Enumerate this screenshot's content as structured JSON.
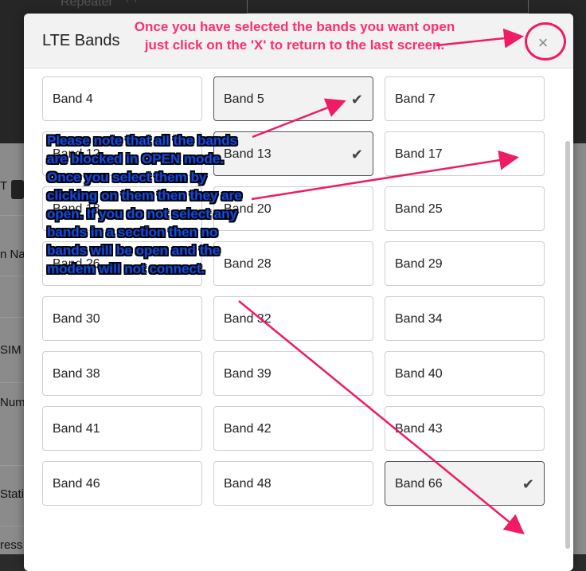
{
  "background": {
    "repeater_label": "Repeater",
    "side_labels": [
      "T",
      "n Na",
      "SIM",
      "Num",
      "Stati",
      "ress"
    ]
  },
  "modal": {
    "title": "LTE Bands",
    "close_symbol": "×",
    "bands": [
      {
        "label": "Band 4",
        "selected": false
      },
      {
        "label": "Band 5",
        "selected": true
      },
      {
        "label": "Band 7",
        "selected": false
      },
      {
        "label": "Band 12",
        "selected": false
      },
      {
        "label": "Band 13",
        "selected": true
      },
      {
        "label": "Band 17",
        "selected": false
      },
      {
        "label": "Band 18",
        "selected": false
      },
      {
        "label": "Band 20",
        "selected": false
      },
      {
        "label": "Band 25",
        "selected": false
      },
      {
        "label": "Band 26",
        "selected": false
      },
      {
        "label": "Band 28",
        "selected": false
      },
      {
        "label": "Band 29",
        "selected": false
      },
      {
        "label": "Band 30",
        "selected": false
      },
      {
        "label": "Band 32",
        "selected": false
      },
      {
        "label": "Band 34",
        "selected": false
      },
      {
        "label": "Band 38",
        "selected": false
      },
      {
        "label": "Band 39",
        "selected": false
      },
      {
        "label": "Band 40",
        "selected": false
      },
      {
        "label": "Band 41",
        "selected": false
      },
      {
        "label": "Band 42",
        "selected": false
      },
      {
        "label": "Band 43",
        "selected": false
      },
      {
        "label": "Band 46",
        "selected": false
      },
      {
        "label": "Band 48",
        "selected": false
      },
      {
        "label": "Band 66",
        "selected": true
      }
    ]
  },
  "annotations": {
    "top_note": "Once you have selected the bands you want open just click on the 'X' to return to the last screen.",
    "left_note": "Please note that all the bands are blocked in OPEN mode.  Once you select them by clicking on them then they are open.  If you do not select any bands in a section then no bands will be open and the modem will not connect.",
    "accent_color": "#ef1b63",
    "note_color": "#1f55e8"
  }
}
